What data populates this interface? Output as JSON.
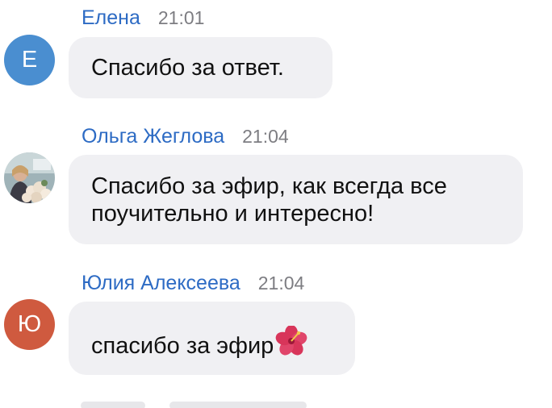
{
  "messages": [
    {
      "author": "Елена",
      "time": "21:01",
      "avatar_letter": "Е",
      "avatar_color": "#4a8ed0",
      "lines": [
        "Спасибо за ответ."
      ]
    },
    {
      "author": "Ольга Жеглова",
      "time": "21:04",
      "avatar_type": "photo",
      "lines": [
        "Спасибо за эфир, как всегда все",
        "поучительно и интересно!"
      ]
    },
    {
      "author": "Юлия Алексеева",
      "time": "21:04",
      "avatar_letter": "Ю",
      "avatar_color": "#cf5a3f",
      "lines": [
        "спасибо за эфир"
      ],
      "emoji": "hibiscus-icon"
    }
  ],
  "colors": {
    "author_link": "#2d6bc4",
    "timestamp": "#7d7d82",
    "bubble_bg": "#f0f0f3",
    "message_text": "#111111"
  }
}
